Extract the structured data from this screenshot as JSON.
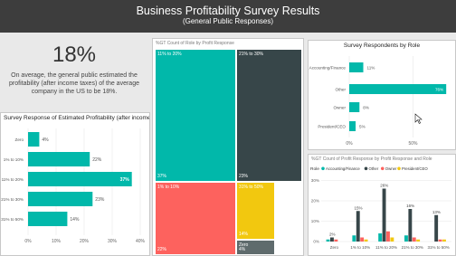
{
  "header": {
    "title": "Business Profitability Survey Results",
    "subtitle": "(General Public Responses)"
  },
  "kpi": {
    "value": "18%",
    "description": "On average, the general public estimated the profitability (after income taxes) of the average company in the US to be 18%."
  },
  "profitability_chart": {
    "title": "Survey Response of Estimated Profitability (after income taxes)",
    "x_ticks": [
      "0%",
      "10%",
      "20%",
      "30%",
      "40%"
    ]
  },
  "treemap": {
    "title": "%GT Count of Role by Profit Response",
    "tiles": [
      {
        "name": "11% to 20%",
        "top": "11% to 20%",
        "bottom": "37%",
        "color": "#01b8aa"
      },
      {
        "name": "21% to 30%",
        "top": "21% to 30%",
        "bottom": "23%",
        "color": "#374649"
      },
      {
        "name": "1% to 10%",
        "top": "1% to 10%",
        "bottom": "22%",
        "color": "#fd625e"
      },
      {
        "name": "31% to 50%",
        "top": "31% to 50%",
        "bottom": "14%",
        "color": "#f2c80f"
      },
      {
        "name": "Zero",
        "top": "Zero",
        "bottom": "4%",
        "color": "#5f6b6d"
      }
    ]
  },
  "roles_chart": {
    "title": "Survey Respondents by Role",
    "x_ticks": [
      "0%",
      "50%"
    ]
  },
  "clustered_chart": {
    "title": "%GT Count of Profit Response by Profit Response and Role",
    "legend_label": "Role",
    "y_ticks": [
      "0%",
      "10%",
      "20%",
      "30%"
    ]
  },
  "colors": {
    "teal": "#01b8aa",
    "dark": "#374649",
    "red": "#fd625e",
    "yellow": "#f2c80f",
    "header": "#3d3d3d"
  },
  "chart_data": [
    {
      "type": "bar",
      "orientation": "horizontal",
      "title": "Survey Response of Estimated Profitability (after income taxes)",
      "categories": [
        "Zero",
        "1% to 10%",
        "11% to 20%",
        "21% to 30%",
        "31% to 50%"
      ],
      "values": [
        4,
        22,
        37,
        23,
        14
      ],
      "labels": [
        "4%",
        "22%",
        "37%",
        "23%",
        "14%"
      ],
      "xlim": [
        0,
        40
      ],
      "color": "#01b8aa"
    },
    {
      "type": "bar",
      "orientation": "horizontal",
      "title": "Survey Respondents by Role",
      "categories": [
        "Accounting/Finance",
        "Other",
        "Owner",
        "President/CEO"
      ],
      "values": [
        11,
        76,
        8,
        5
      ],
      "labels": [
        "11%",
        "76%",
        "8%",
        "5%"
      ],
      "xlim": [
        0,
        78
      ],
      "color": "#01b8aa"
    },
    {
      "type": "bar",
      "title": "%GT Count of Profit Response by Profit Response and Role",
      "categories": [
        "Zero",
        "1% to 10%",
        "11% to 20%",
        "21% to 30%",
        "31% to 50%"
      ],
      "series": [
        {
          "name": "Accounting/Finance",
          "values": [
            1,
            3,
            4,
            3,
            0
          ],
          "color": "#01b8aa"
        },
        {
          "name": "Other",
          "values": [
            2,
            15,
            26,
            16,
            13
          ],
          "color": "#374649"
        },
        {
          "name": "Owner",
          "values": [
            1,
            2,
            5,
            2,
            1
          ],
          "color": "#fd625e"
        },
        {
          "name": "President/CEO",
          "values": [
            0,
            1,
            2,
            1,
            1
          ],
          "color": "#f2c80f"
        }
      ],
      "labels": [
        "2%",
        "15%",
        "26%",
        "16%",
        "13%"
      ],
      "ylim": [
        0,
        32
      ]
    }
  ]
}
